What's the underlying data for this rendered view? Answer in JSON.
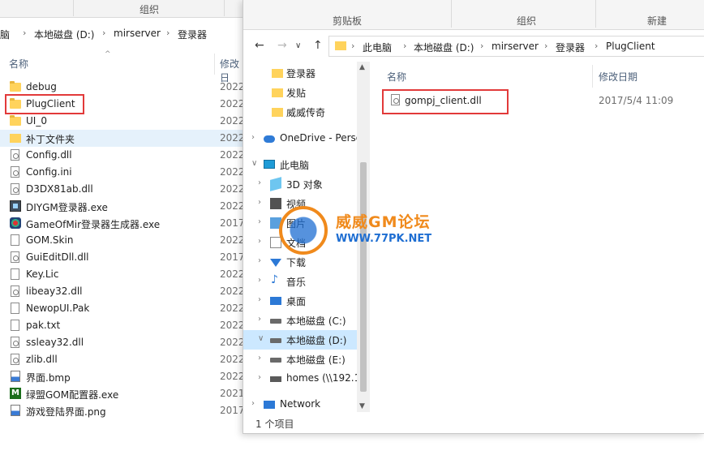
{
  "back_window": {
    "ribbon_group_label": "组织",
    "breadcrumb": [
      "此电脑",
      "本地磁盘 (D:)",
      "mirserver",
      "登录器"
    ],
    "breadcrumb_visible_first": "脑",
    "columns": {
      "name": "名称",
      "date": "修改日"
    },
    "items": [
      {
        "name": "debug",
        "date": "2022",
        "icon": "folder-icon"
      },
      {
        "name": "PlugClient",
        "date": "2022",
        "icon": "folder-icon"
      },
      {
        "name": "UI_0",
        "date": "2022",
        "icon": "folder-icon"
      },
      {
        "name": "补丁文件夹",
        "date": "2022",
        "icon": "folder-icon"
      },
      {
        "name": "Config.dll",
        "date": "2022",
        "icon": "dll-icon"
      },
      {
        "name": "Config.ini",
        "date": "2022",
        "icon": "settings-file-icon"
      },
      {
        "name": "D3DX81ab.dll",
        "date": "2022",
        "icon": "dll-icon"
      },
      {
        "name": "DIYGM登录器.exe",
        "date": "2022",
        "icon": "exe-icon"
      },
      {
        "name": "GameOfMir登录器生成器.exe",
        "date": "2017",
        "icon": "game-exe-icon"
      },
      {
        "name": "GOM.Skin",
        "date": "2022",
        "icon": "file-icon"
      },
      {
        "name": "GuiEditDll.dll",
        "date": "2017",
        "icon": "dll-icon"
      },
      {
        "name": "Key.Lic",
        "date": "2022",
        "icon": "file-icon"
      },
      {
        "name": "libeay32.dll",
        "date": "2022",
        "icon": "dll-icon"
      },
      {
        "name": "NewopUI.Pak",
        "date": "2022",
        "icon": "file-icon"
      },
      {
        "name": "pak.txt",
        "date": "2022",
        "icon": "text-file-icon"
      },
      {
        "name": "ssleay32.dll",
        "date": "2022",
        "icon": "dll-icon"
      },
      {
        "name": "zlib.dll",
        "date": "2022",
        "icon": "dll-icon"
      },
      {
        "name": "界面.bmp",
        "date": "2022",
        "icon": "image-file-icon"
      },
      {
        "name": "绿盟GOM配置器.exe",
        "date": "2021",
        "icon": "green-exe-icon"
      },
      {
        "name": "游戏登陆界面.png",
        "date": "2017",
        "icon": "image-file-icon"
      }
    ]
  },
  "front_window": {
    "ribbon": {
      "clipboard": "剪贴板",
      "organize": "组织",
      "new": "新建"
    },
    "breadcrumb": [
      "此电脑",
      "本地磁盘 (D:)",
      "mirserver",
      "登录器",
      "PlugClient"
    ],
    "nav_items": [
      {
        "label": "登录器",
        "icon": "folder-icon"
      },
      {
        "label": "发贴",
        "icon": "folder-icon"
      },
      {
        "label": "威威传奇",
        "icon": "folder-icon"
      },
      {
        "label": "OneDrive - Perso",
        "icon": "onedrive-icon"
      },
      {
        "label": "此电脑",
        "icon": "pc-icon"
      },
      {
        "label": "3D 对象",
        "icon": "3d-objects-icon"
      },
      {
        "label": "视频",
        "icon": "video-icon"
      },
      {
        "label": "图片",
        "icon": "pictures-icon"
      },
      {
        "label": "文档",
        "icon": "documents-icon"
      },
      {
        "label": "下载",
        "icon": "download-icon"
      },
      {
        "label": "音乐",
        "icon": "music-icon"
      },
      {
        "label": "桌面",
        "icon": "desktop-icon"
      },
      {
        "label": "本地磁盘 (C:)",
        "icon": "drive-icon"
      },
      {
        "label": "本地磁盘 (D:)",
        "icon": "drive-icon"
      },
      {
        "label": "本地磁盘 (E:)",
        "icon": "drive-icon"
      },
      {
        "label": "homes (\\\\192.1",
        "icon": "network-drive-icon"
      },
      {
        "label": "Network",
        "icon": "network-icon"
      }
    ],
    "columns": {
      "name": "名称",
      "date": "修改日期"
    },
    "files": [
      {
        "name": "gompj_client.dll",
        "date": "2017/5/4 11:09",
        "icon": "dll-icon"
      }
    ],
    "status": "1 个项目"
  },
  "watermark": {
    "title": "威威GM论坛",
    "url": "WWW.77PK.NET"
  },
  "colors": {
    "highlight": "#e23a3a",
    "selection": "#cce8ff",
    "folder": "#ffd35c"
  }
}
